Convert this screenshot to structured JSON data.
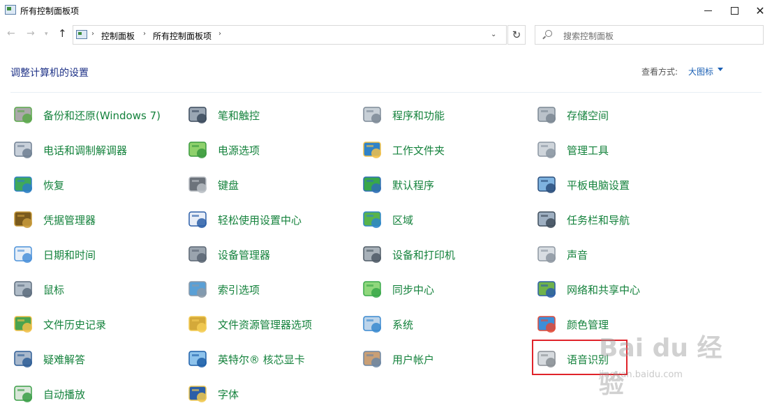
{
  "window": {
    "title": "所有控制面板项"
  },
  "address": {
    "crumbs": [
      "控制面板",
      "所有控制面板项"
    ],
    "search_placeholder": "搜索控制面板"
  },
  "header": {
    "heading": "调整计算机的设置",
    "view_label": "查看方式:",
    "view_value": "大图标"
  },
  "columns": [
    [
      {
        "label": "备份和还原(Windows 7)",
        "icon": "backup-restore-icon"
      },
      {
        "label": "电话和调制解调器",
        "icon": "phone-modem-icon"
      },
      {
        "label": "恢复",
        "icon": "recovery-icon"
      },
      {
        "label": "凭据管理器",
        "icon": "credential-manager-icon"
      },
      {
        "label": "日期和时间",
        "icon": "date-time-icon"
      },
      {
        "label": "鼠标",
        "icon": "mouse-icon"
      },
      {
        "label": "文件历史记录",
        "icon": "file-history-icon"
      },
      {
        "label": "疑难解答",
        "icon": "troubleshooting-icon"
      },
      {
        "label": "自动播放",
        "icon": "autoplay-icon"
      }
    ],
    [
      {
        "label": "笔和触控",
        "icon": "pen-touch-icon"
      },
      {
        "label": "电源选项",
        "icon": "power-options-icon"
      },
      {
        "label": "键盘",
        "icon": "keyboard-icon"
      },
      {
        "label": "轻松使用设置中心",
        "icon": "ease-of-access-icon"
      },
      {
        "label": "设备管理器",
        "icon": "device-manager-icon"
      },
      {
        "label": "索引选项",
        "icon": "indexing-options-icon"
      },
      {
        "label": "文件资源管理器选项",
        "icon": "explorer-options-icon"
      },
      {
        "label": "英特尔® 核芯显卡",
        "icon": "intel-graphics-icon"
      },
      {
        "label": "字体",
        "icon": "fonts-icon"
      }
    ],
    [
      {
        "label": "程序和功能",
        "icon": "programs-features-icon"
      },
      {
        "label": "工作文件夹",
        "icon": "work-folders-icon"
      },
      {
        "label": "默认程序",
        "icon": "default-programs-icon"
      },
      {
        "label": "区域",
        "icon": "region-icon"
      },
      {
        "label": "设备和打印机",
        "icon": "devices-printers-icon"
      },
      {
        "label": "同步中心",
        "icon": "sync-center-icon"
      },
      {
        "label": "系统",
        "icon": "system-icon"
      },
      {
        "label": "用户帐户",
        "icon": "user-accounts-icon"
      }
    ],
    [
      {
        "label": "存储空间",
        "icon": "storage-spaces-icon"
      },
      {
        "label": "管理工具",
        "icon": "admin-tools-icon"
      },
      {
        "label": "平板电脑设置",
        "icon": "tablet-settings-icon"
      },
      {
        "label": "任务栏和导航",
        "icon": "taskbar-navigation-icon"
      },
      {
        "label": "声音",
        "icon": "sound-icon"
      },
      {
        "label": "网络和共享中心",
        "icon": "network-sharing-icon"
      },
      {
        "label": "颜色管理",
        "icon": "color-management-icon"
      },
      {
        "label": "语音识别",
        "icon": "speech-recognition-icon"
      }
    ]
  ],
  "watermark": {
    "brand": "Bai du 经验",
    "url": "jingyan.baidu.com"
  }
}
